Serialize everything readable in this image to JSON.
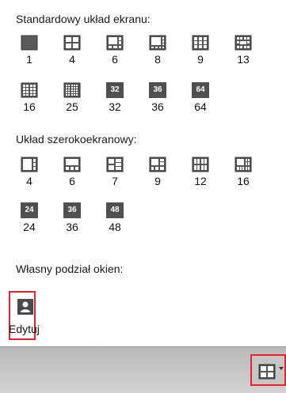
{
  "sections": {
    "standard_title": "Standardowy układ ekranu:",
    "wide_title": "Układ szerokoekranowy:",
    "custom_title": "Własny podział okien:"
  },
  "standard": [
    {
      "label": "1",
      "icon": "layout-1-icon"
    },
    {
      "label": "4",
      "icon": "layout-4-icon"
    },
    {
      "label": "6",
      "icon": "layout-6-icon"
    },
    {
      "label": "8",
      "icon": "layout-8-icon"
    },
    {
      "label": "9",
      "icon": "layout-9-icon"
    },
    {
      "label": "13",
      "icon": "layout-13-icon"
    },
    {
      "label": "16",
      "icon": "layout-16-icon"
    },
    {
      "label": "25",
      "icon": "layout-25-icon"
    },
    {
      "label": "32",
      "icon": "layout-32-icon",
      "badge": "32"
    },
    {
      "label": "36",
      "icon": "layout-36-icon",
      "badge": "36"
    },
    {
      "label": "64",
      "icon": "layout-64-icon",
      "badge": "64"
    }
  ],
  "wide": [
    {
      "label": "4",
      "icon": "wide-layout-4-icon"
    },
    {
      "label": "6",
      "icon": "wide-layout-6-icon"
    },
    {
      "label": "7",
      "icon": "wide-layout-7-icon"
    },
    {
      "label": "9",
      "icon": "wide-layout-9-icon"
    },
    {
      "label": "12",
      "icon": "wide-layout-12-icon"
    },
    {
      "label": "16",
      "icon": "wide-layout-16-icon"
    },
    {
      "label": "24",
      "icon": "wide-layout-24-icon",
      "badge": "24"
    },
    {
      "label": "36",
      "icon": "wide-layout-36-icon",
      "badge": "36"
    },
    {
      "label": "48",
      "icon": "wide-layout-48-icon",
      "badge": "48"
    }
  ],
  "custom": {
    "edit_label": "Edytuj",
    "edit_icon": "user-icon"
  },
  "footer": {
    "layout_button_icon": "grid-layout-icon",
    "accent": "#e8212b"
  }
}
